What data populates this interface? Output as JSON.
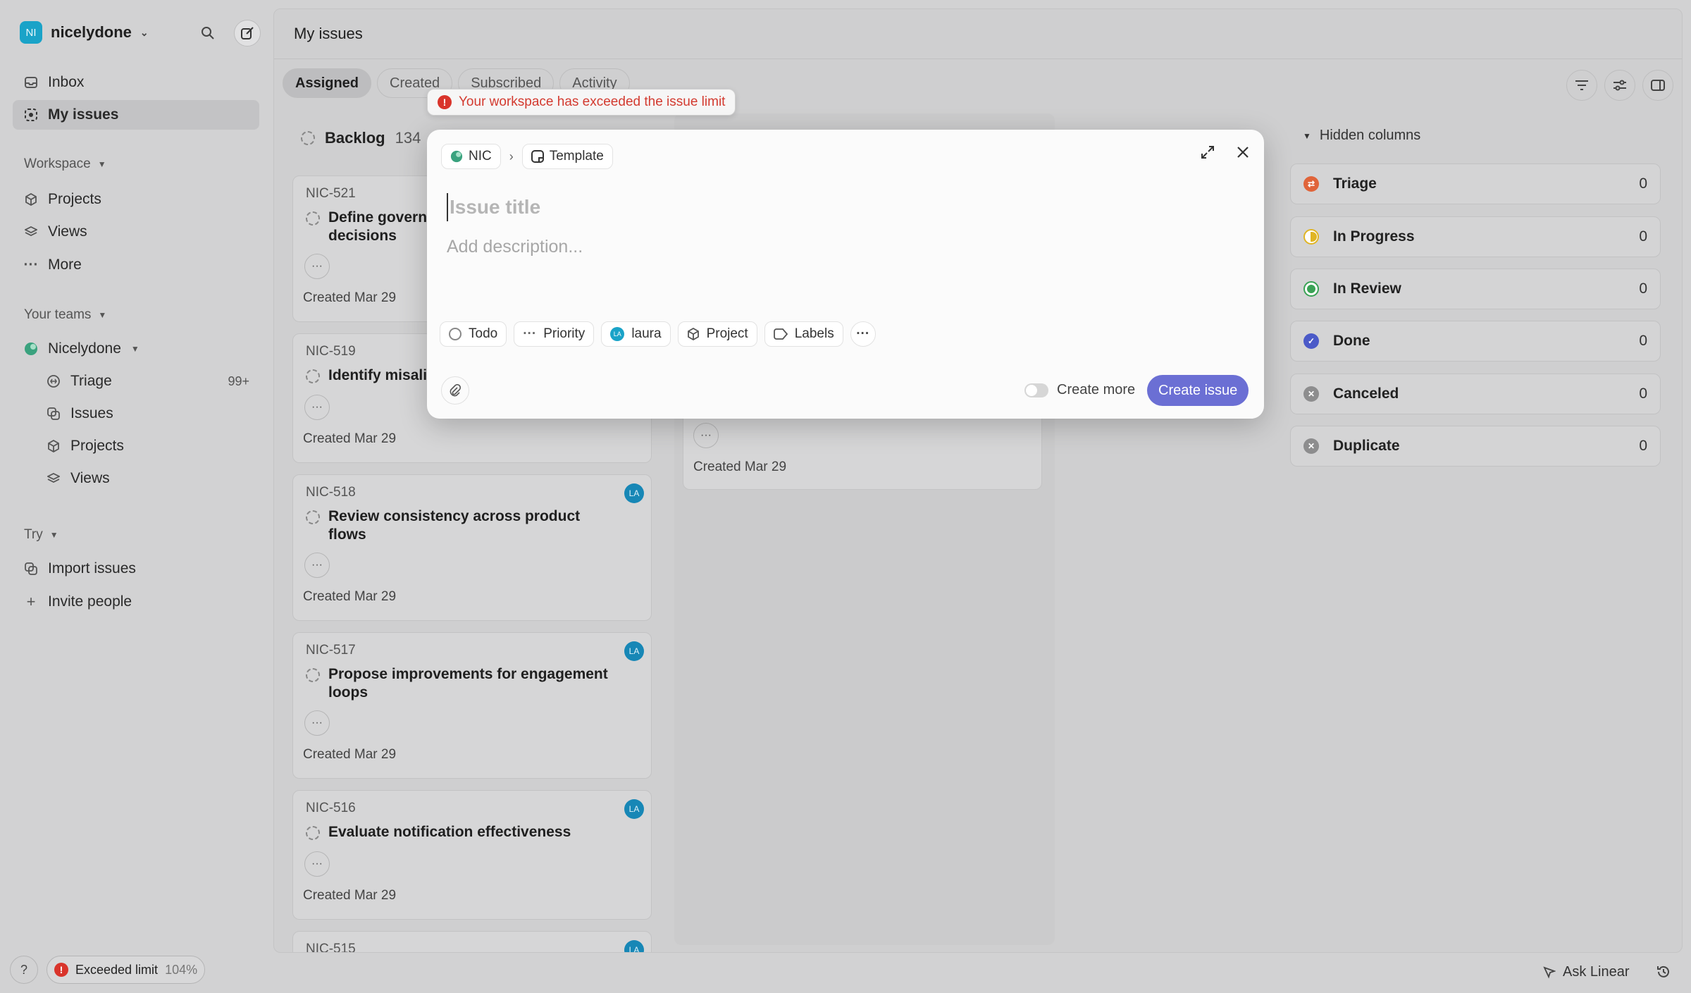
{
  "workspace": {
    "name": "nicelydone",
    "initials": "NI"
  },
  "sidebar": {
    "inbox": "Inbox",
    "my_issues": "My issues",
    "workspace_header": "Workspace",
    "projects": "Projects",
    "views": "Views",
    "more": "More",
    "your_teams": "Your teams",
    "team_name": "Nicelydone",
    "triage": "Triage",
    "triage_count": "99+",
    "issues": "Issues",
    "team_projects": "Projects",
    "team_views": "Views",
    "try": "Try",
    "import_issues": "Import issues",
    "invite_people": "Invite people"
  },
  "footer": {
    "help": "?",
    "limit_label": "Exceeded limit",
    "limit_pct": "104%",
    "ask": "Ask Linear"
  },
  "main": {
    "title": "My issues",
    "tabs": [
      "Assigned",
      "Created",
      "Subscribed",
      "Activity"
    ],
    "backlog_label": "Backlog",
    "backlog_count": "134",
    "cards": [
      {
        "id": "NIC-521",
        "title": "Define governance for product decisions",
        "title_visible": "Define govern",
        "title_line2": "decisions",
        "created": "Created Mar 29",
        "avatar": ""
      },
      {
        "id": "NIC-519",
        "title": "Identify misalignment",
        "title_visible": "Identify misali",
        "title_line2": "",
        "created": "Created Mar 29",
        "avatar": ""
      },
      {
        "id": "NIC-518",
        "title": "Review consistency across product flows",
        "title_visible": "Review consistency across product",
        "title_line2": "flows",
        "created": "Created Mar 29",
        "avatar": "LA"
      },
      {
        "id": "NIC-517",
        "title": "Propose improvements for engagement loops",
        "title_visible": "Propose improvements for engagement",
        "title_line2": "loops",
        "created": "Created Mar 29",
        "avatar": "LA"
      },
      {
        "id": "NIC-516",
        "title": "Evaluate notification effectiveness",
        "title_visible": "Evaluate notification effectiveness",
        "title_line2": "",
        "created": "Created Mar 29",
        "avatar": "LA"
      },
      {
        "id": "NIC-515",
        "title": "",
        "title_visible": "",
        "title_line2": "",
        "created": "",
        "avatar": "LA"
      }
    ],
    "ghost_created": "Created Mar 29",
    "hidden_columns_label": "Hidden columns",
    "hidden_columns": [
      {
        "name": "Triage",
        "count": "0",
        "color": "#e0643a"
      },
      {
        "name": "In Progress",
        "count": "0",
        "color": "#e0b524"
      },
      {
        "name": "In Review",
        "count": "0",
        "color": "#3aa255"
      },
      {
        "name": "Done",
        "count": "0",
        "color": "#4b5ac8"
      },
      {
        "name": "Canceled",
        "count": "0",
        "color": "#8d8d8e"
      },
      {
        "name": "Duplicate",
        "count": "0",
        "color": "#8d8d8e"
      }
    ]
  },
  "toast": {
    "message": "Your workspace has exceeded the issue limit"
  },
  "modal": {
    "team": "NIC",
    "template": "Template",
    "title_placeholder": "Issue title",
    "desc_placeholder": "Add description...",
    "status": "Todo",
    "priority": "Priority",
    "assignee": "laura",
    "assignee_initials": "LA",
    "project": "Project",
    "labels": "Labels",
    "create_more": "Create more",
    "create_issue": "Create issue"
  },
  "colors": {
    "accent": "#6b6fd4",
    "error": "#d9342b",
    "avatar": "#1aa3c8"
  }
}
